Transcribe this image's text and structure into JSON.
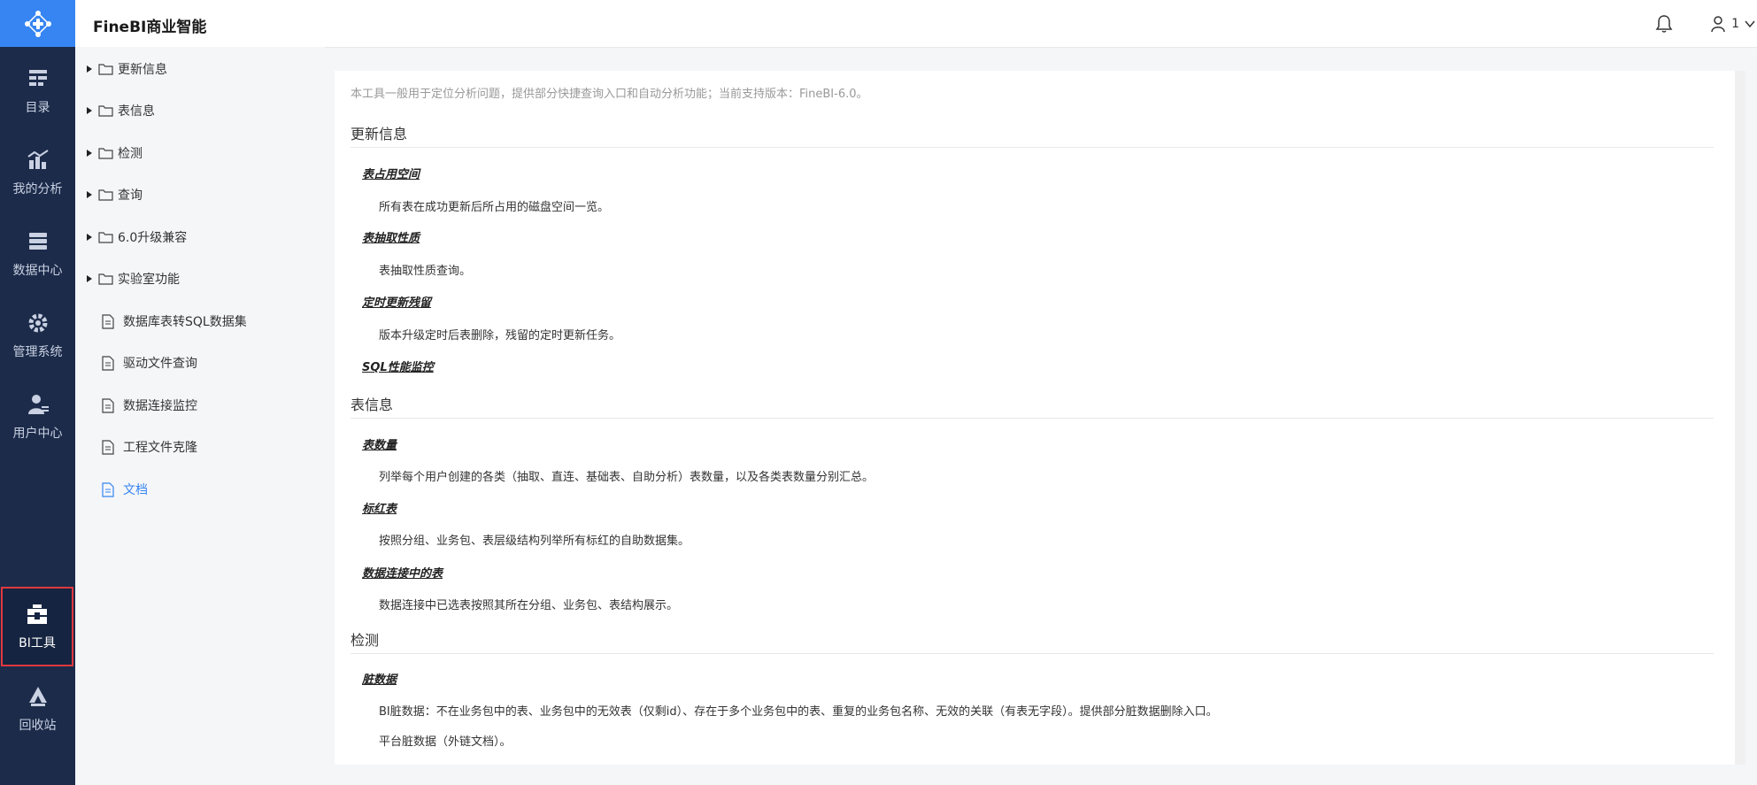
{
  "app": {
    "title": "FineBI商业智能"
  },
  "header": {
    "user_name": "1"
  },
  "nav": {
    "items": [
      {
        "label": "目录",
        "icon": "catalog-icon"
      },
      {
        "label": "我的分析",
        "icon": "analysis-icon"
      },
      {
        "label": "数据中心",
        "icon": "data-center-icon"
      },
      {
        "label": "管理系统",
        "icon": "gear-icon"
      },
      {
        "label": "用户中心",
        "icon": "user-center-icon"
      },
      {
        "label": "BI工具",
        "icon": "toolbox-icon",
        "active": true
      },
      {
        "label": "回收站",
        "icon": "recycle-icon"
      }
    ]
  },
  "tree": {
    "folders": [
      "更新信息",
      "表信息",
      "检测",
      "查询",
      "6.0升级兼容",
      "实验室功能"
    ],
    "files": [
      "数据库表转SQL数据集",
      "驱动文件查询",
      "数据连接监控",
      "工程文件克隆",
      "文档"
    ],
    "selected": "文档"
  },
  "content": {
    "intro": "本工具一般用于定位分析问题，提供部分快捷查询入口和自动分析功能；当前支持版本：FineBI-6.0。",
    "sections": [
      {
        "title": "更新信息",
        "items": [
          {
            "title": "表占用空间",
            "desc": [
              "所有表在成功更新后所占用的磁盘空间一览。"
            ]
          },
          {
            "title": "表抽取性质",
            "desc": [
              "表抽取性质查询。"
            ]
          },
          {
            "title": "定时更新残留",
            "desc": [
              "版本升级定时后表删除，残留的定时更新任务。"
            ]
          },
          {
            "title": "SQL性能监控",
            "desc": []
          }
        ]
      },
      {
        "title": "表信息",
        "items": [
          {
            "title": "表数量",
            "desc": [
              "列举每个用户创建的各类（抽取、直连、基础表、自助分析）表数量，以及各类表数量分别汇总。"
            ]
          },
          {
            "title": "标红表",
            "desc": [
              "按照分组、业务包、表层级结构列举所有标红的自助数据集。"
            ]
          },
          {
            "title": "数据连接中的表",
            "desc": [
              "数据连接中已选表按照其所在分组、业务包、表结构展示。"
            ]
          }
        ]
      },
      {
        "title": "检测",
        "items": [
          {
            "title": "脏数据",
            "desc": [
              "BI脏数据：不在业务包中的表、业务包中的无效表（仅剩id）、存在于多个业务包中的表、重复的业务包名称、无效的关联（有表无字段）。提供部分脏数据删除入口。",
              "平台脏数据（外链文档）。"
            ]
          }
        ]
      }
    ]
  }
}
